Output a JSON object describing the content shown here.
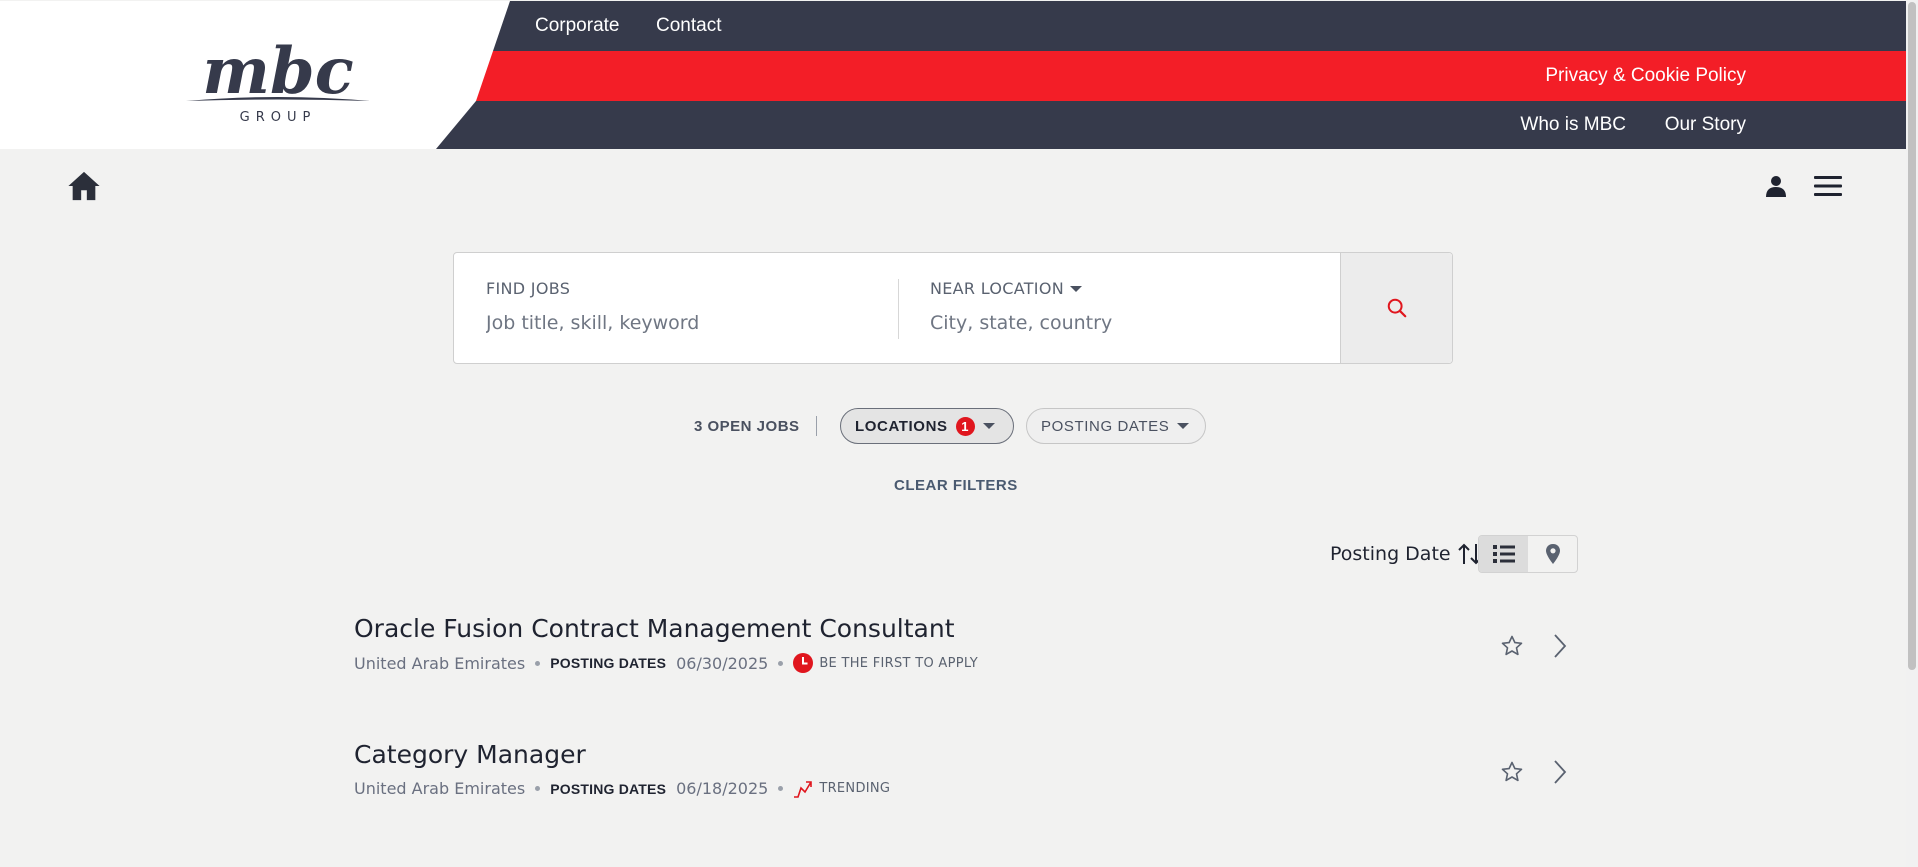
{
  "header": {
    "logo_text": "mbc",
    "logo_subtext": "GROUP",
    "top_nav": [
      "Corporate",
      "Contact"
    ],
    "policy_link": "Privacy & Cookie Policy",
    "sub_nav": [
      "Who is MBC",
      "Our Story"
    ]
  },
  "colors": {
    "navy": "#363a4b",
    "red": "#f31e27",
    "background": "#f2f2f1"
  },
  "icons": {
    "home": "home-icon",
    "user": "user-icon",
    "menu": "hamburger-menu-icon",
    "search": "search-icon",
    "list_view": "list-icon",
    "map_view": "map-pin-icon",
    "favorite": "star-icon",
    "open": "chevron-right-icon"
  },
  "search": {
    "find_label": "FIND JOBS",
    "find_placeholder": "Job title, skill, keyword",
    "location_label": "NEAR LOCATION",
    "location_placeholder": "City, state, country"
  },
  "filters": {
    "open_jobs": "3 OPEN JOBS",
    "locations_label": "LOCATIONS",
    "locations_count": "1",
    "posting_dates_label": "POSTING DATES",
    "clear": "CLEAR FILTERS"
  },
  "sort": {
    "label": "Posting Date"
  },
  "jobs": [
    {
      "title": "Oracle Fusion Contract Management Consultant",
      "location": "United Arab Emirates",
      "date_label": "POSTING DATES",
      "date": "06/30/2025",
      "tag": "BE THE FIRST TO APPLY"
    },
    {
      "title": "Category Manager",
      "location": "United Arab Emirates",
      "date_label": "POSTING DATES",
      "date": "06/18/2025",
      "tag": "TRENDING"
    }
  ]
}
